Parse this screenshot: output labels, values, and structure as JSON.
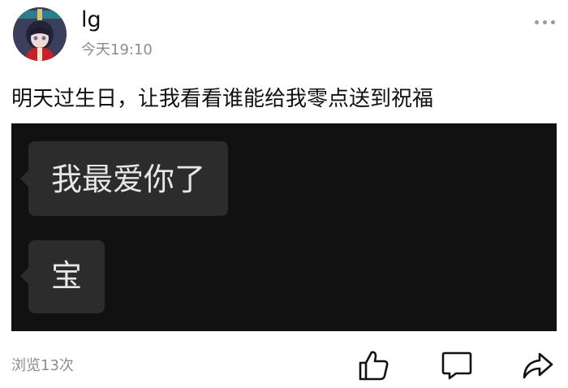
{
  "post": {
    "author": {
      "name": "lg",
      "time": "今天19:10"
    },
    "text": "明天过生日，让我看看谁能给我零点送到祝福",
    "image": {
      "messages": [
        {
          "text": "我最爱你了"
        },
        {
          "text": "宝"
        }
      ]
    },
    "views": "浏览13次",
    "actions": {
      "like_icon": "thumbs-up-icon",
      "comment_icon": "comment-icon",
      "share_icon": "share-icon",
      "more_icon": "more-dots-icon"
    }
  }
}
